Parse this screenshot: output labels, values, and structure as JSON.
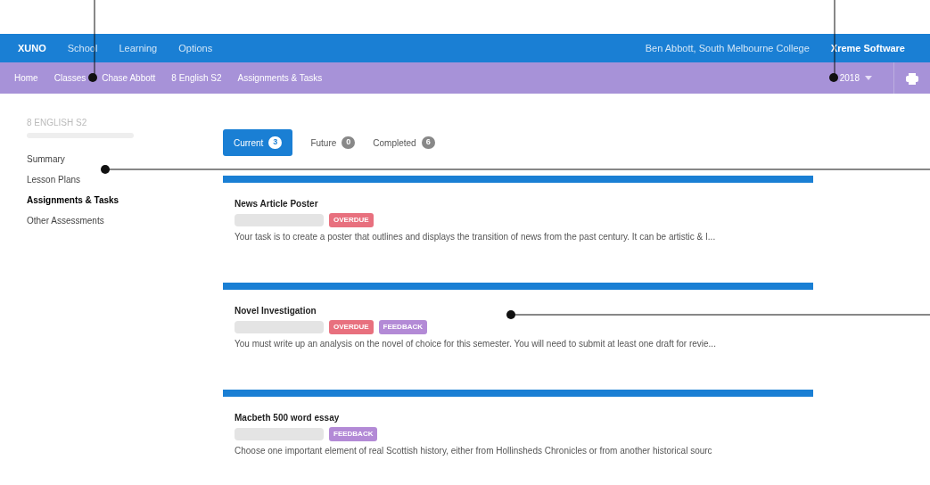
{
  "top_nav": {
    "brand": "XUNO",
    "items": [
      {
        "label": "School",
        "selected": false
      },
      {
        "label": "Learning",
        "selected": false
      },
      {
        "label": "Options",
        "selected": false
      }
    ],
    "user": "Ben Abbott, South Melbourne College",
    "vendor": "Xreme Software"
  },
  "breadcrumbs": [
    "Home",
    "Classes",
    "Chase Abbott",
    "8 English S2",
    "Assignments & Tasks"
  ],
  "year": "2018",
  "sidebar": {
    "title": "8 ENGLISH S2",
    "items": [
      {
        "label": "Summary",
        "selected": false
      },
      {
        "label": "Lesson Plans",
        "selected": false
      },
      {
        "label": "Assignments & Tasks",
        "selected": true
      },
      {
        "label": "Other Assessments",
        "selected": false
      }
    ]
  },
  "tabs": [
    {
      "label": "Current",
      "count": "3",
      "selected": true
    },
    {
      "label": "Future",
      "count": "0",
      "selected": false
    },
    {
      "label": "Completed",
      "count": "6",
      "selected": false
    }
  ],
  "tasks": [
    {
      "title": "News Article Poster",
      "tags": [
        {
          "label": "OVERDUE",
          "color": "#e8707e"
        }
      ],
      "description": "Your task is to create a poster that outlines and displays the transition of news from the past century. It can be artistic & I..."
    },
    {
      "title": "Novel Investigation",
      "tags": [
        {
          "label": "OVERDUE",
          "color": "#e8707e"
        },
        {
          "label": "FEEDBACK",
          "color": "#b38ad6"
        }
      ],
      "description": "You must write up an analysis on the novel of choice for this semester. You will need to submit at least one draft for revie..."
    },
    {
      "title": "Macbeth 500 word essay",
      "tags": [
        {
          "label": "FEEDBACK",
          "color": "#b38ad6"
        }
      ],
      "description": "Choose one important element of real Scottish history, either from Hollinsheds Chronicles or from another historical sourc"
    }
  ]
}
